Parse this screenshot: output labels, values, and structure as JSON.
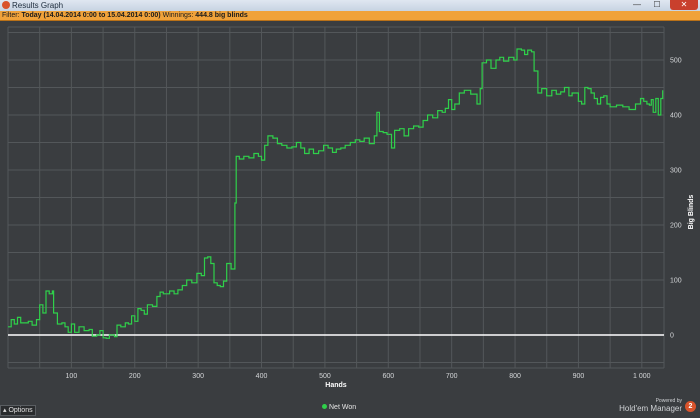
{
  "window": {
    "title": "Results Graph",
    "minimize_glyph": "—",
    "maximize_glyph": "☐",
    "close_glyph": "✕"
  },
  "filter": {
    "prefix": "Filter:",
    "range": "Today (14.04.2014 0:00 to 15.04.2014 0:00)",
    "winnings_label": "Winnings:",
    "winnings_value": "444.8 big blinds"
  },
  "legend": {
    "net_won": "Net Won"
  },
  "options_label": "Options",
  "branding": {
    "powered_by": "Powered by",
    "name": "Hold'em Manager",
    "logo_text": "2"
  },
  "colors": {
    "line": "#2fd04a",
    "zero_line": "#ffffff",
    "background": "#3a3d40",
    "filter_bar": "#f0a23a"
  },
  "chart_data": {
    "type": "line",
    "xlabel": "Hands",
    "ylabel": "Big Blinds",
    "xlim": [
      0,
      1035
    ],
    "ylim": [
      -60,
      560
    ],
    "x_ticks": [
      "100",
      "200",
      "300",
      "400",
      "500",
      "600",
      "700",
      "800",
      "900",
      "1 000"
    ],
    "y_ticks": [
      "0",
      "100",
      "200",
      "300",
      "400",
      "500"
    ],
    "grid": true,
    "legend_position": "bottom-center",
    "series": [
      {
        "name": "Net Won",
        "points": [
          [
            0,
            15
          ],
          [
            5,
            28
          ],
          [
            10,
            20
          ],
          [
            15,
            32
          ],
          [
            20,
            22
          ],
          [
            28,
            22
          ],
          [
            32,
            25
          ],
          [
            38,
            18
          ],
          [
            45,
            28
          ],
          [
            50,
            55
          ],
          [
            55,
            40
          ],
          [
            60,
            80
          ],
          [
            65,
            75
          ],
          [
            70,
            80
          ],
          [
            72,
            40
          ],
          [
            78,
            20
          ],
          [
            85,
            22
          ],
          [
            90,
            15
          ],
          [
            95,
            5
          ],
          [
            100,
            20
          ],
          [
            105,
            5
          ],
          [
            112,
            15
          ],
          [
            120,
            8
          ],
          [
            128,
            10
          ],
          [
            133,
            -2
          ],
          [
            140,
            0
          ],
          [
            145,
            8
          ],
          [
            150,
            -5
          ],
          [
            155,
            -6
          ],
          [
            160,
            0
          ],
          [
            168,
            -3
          ],
          [
            172,
            18
          ],
          [
            178,
            15
          ],
          [
            185,
            22
          ],
          [
            190,
            20
          ],
          [
            195,
            35
          ],
          [
            200,
            25
          ],
          [
            205,
            48
          ],
          [
            210,
            45
          ],
          [
            215,
            38
          ],
          [
            220,
            55
          ],
          [
            228,
            52
          ],
          [
            235,
            70
          ],
          [
            240,
            78
          ],
          [
            245,
            75
          ],
          [
            255,
            80
          ],
          [
            262,
            75
          ],
          [
            268,
            82
          ],
          [
            275,
            90
          ],
          [
            282,
            100
          ],
          [
            290,
            95
          ],
          [
            298,
            112
          ],
          [
            305,
            108
          ],
          [
            310,
            140
          ],
          [
            315,
            142
          ],
          [
            320,
            130
          ],
          [
            325,
            95
          ],
          [
            330,
            90
          ],
          [
            335,
            88
          ],
          [
            340,
            98
          ],
          [
            345,
            130
          ],
          [
            352,
            120
          ],
          [
            358,
            240
          ],
          [
            360,
            325
          ],
          [
            365,
            320
          ],
          [
            372,
            325
          ],
          [
            380,
            322
          ],
          [
            388,
            330
          ],
          [
            395,
            325
          ],
          [
            400,
            318
          ],
          [
            405,
            345
          ],
          [
            410,
            362
          ],
          [
            418,
            358
          ],
          [
            425,
            348
          ],
          [
            432,
            345
          ],
          [
            440,
            340
          ],
          [
            448,
            342
          ],
          [
            455,
            350
          ],
          [
            462,
            340
          ],
          [
            468,
            330
          ],
          [
            475,
            338
          ],
          [
            482,
            330
          ],
          [
            490,
            335
          ],
          [
            498,
            345
          ],
          [
            505,
            340
          ],
          [
            512,
            332
          ],
          [
            518,
            338
          ],
          [
            525,
            340
          ],
          [
            532,
            345
          ],
          [
            540,
            350
          ],
          [
            548,
            355
          ],
          [
            555,
            352
          ],
          [
            562,
            358
          ],
          [
            570,
            348
          ],
          [
            578,
            362
          ],
          [
            582,
            405
          ],
          [
            586,
            370
          ],
          [
            592,
            368
          ],
          [
            598,
            365
          ],
          [
            605,
            340
          ],
          [
            610,
            372
          ],
          [
            618,
            375
          ],
          [
            625,
            362
          ],
          [
            632,
            375
          ],
          [
            640,
            380
          ],
          [
            648,
            378
          ],
          [
            655,
            390
          ],
          [
            662,
            400
          ],
          [
            670,
            395
          ],
          [
            678,
            408
          ],
          [
            685,
            405
          ],
          [
            690,
            412
          ],
          [
            695,
            428
          ],
          [
            700,
            410
          ],
          [
            705,
            420
          ],
          [
            712,
            440
          ],
          [
            720,
            445
          ],
          [
            730,
            438
          ],
          [
            740,
            420
          ],
          [
            745,
            448
          ],
          [
            748,
            495
          ],
          [
            755,
            500
          ],
          [
            762,
            485
          ],
          [
            770,
            500
          ],
          [
            776,
            505
          ],
          [
            782,
            498
          ],
          [
            790,
            505
          ],
          [
            798,
            500
          ],
          [
            803,
            520
          ],
          [
            810,
            518
          ],
          [
            815,
            510
          ],
          [
            820,
            518
          ],
          [
            826,
            515
          ],
          [
            830,
            480
          ],
          [
            836,
            440
          ],
          [
            842,
            448
          ],
          [
            850,
            435
          ],
          [
            858,
            445
          ],
          [
            865,
            438
          ],
          [
            872,
            442
          ],
          [
            878,
            450
          ],
          [
            885,
            435
          ],
          [
            890,
            440
          ],
          [
            895,
            440
          ],
          [
            900,
            425
          ],
          [
            905,
            420
          ],
          [
            910,
            450
          ],
          [
            915,
            448
          ],
          [
            920,
            440
          ],
          [
            925,
            430
          ],
          [
            930,
            420
          ],
          [
            935,
            432
          ],
          [
            940,
            435
          ],
          [
            945,
            420
          ],
          [
            950,
            415
          ],
          [
            960,
            418
          ],
          [
            970,
            415
          ],
          [
            980,
            410
          ],
          [
            990,
            420
          ],
          [
            998,
            430
          ],
          [
            1003,
            425
          ],
          [
            1008,
            420
          ],
          [
            1012,
            418
          ],
          [
            1015,
            428
          ],
          [
            1018,
            405
          ],
          [
            1022,
            430
          ],
          [
            1026,
            400
          ],
          [
            1030,
            430
          ],
          [
            1033,
            445
          ]
        ]
      }
    ]
  }
}
